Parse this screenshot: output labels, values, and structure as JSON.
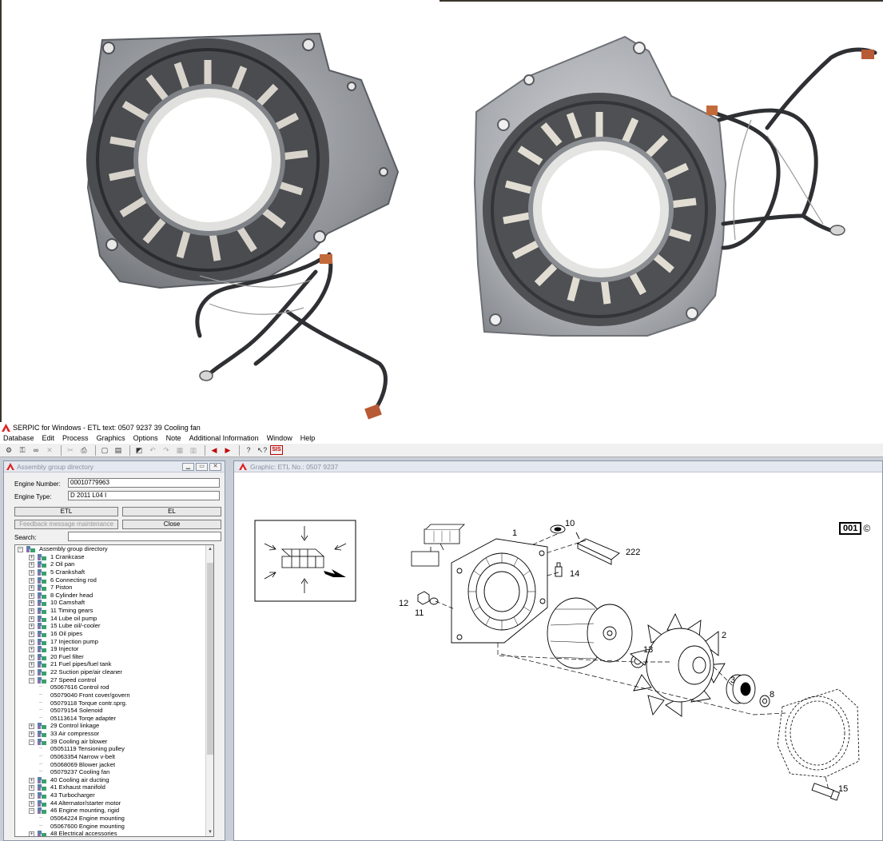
{
  "window": {
    "title": "SERPIC for Windows - ETL text: 0507 9237   39   Cooling fan"
  },
  "menu": [
    "Database",
    "Edit",
    "Process",
    "Graphics",
    "Options",
    "Note",
    "Additional Information",
    "Window",
    "Help"
  ],
  "toolbar": {
    "sis_label": "SIS"
  },
  "left_pane": {
    "title": "Assembly group directory",
    "engine_number_label": "Engine Number:",
    "engine_number_value": "00010779963",
    "engine_type_label": "Engine Type:",
    "engine_type_value": "D 2011 L04 I",
    "etl_button": "ETL",
    "el_button": "EL",
    "feedback_button": "Feedback message maintenance",
    "close_button": "Close",
    "search_label": "Search:",
    "search_value": "",
    "tree": [
      {
        "type": "root",
        "label": "Assembly group directory"
      },
      {
        "type": "group",
        "label": "1  Crankcase"
      },
      {
        "type": "group",
        "label": "2  Oil pan"
      },
      {
        "type": "group",
        "label": "5  Crankshaft"
      },
      {
        "type": "group",
        "label": "6  Connecting rod"
      },
      {
        "type": "group",
        "label": "7  Piston"
      },
      {
        "type": "group",
        "label": "8  Cylinder head"
      },
      {
        "type": "group",
        "label": "10  Camshaft"
      },
      {
        "type": "group",
        "label": "11  Timing gears"
      },
      {
        "type": "group",
        "label": "14  Lube oil pump"
      },
      {
        "type": "group",
        "label": "15  Lube oil/-cooler"
      },
      {
        "type": "group",
        "label": "16  Oil pipes"
      },
      {
        "type": "group",
        "label": "17  Injection pump"
      },
      {
        "type": "group",
        "label": "19  Injector"
      },
      {
        "type": "group",
        "label": "20  Fuel filter"
      },
      {
        "type": "group",
        "label": "21  Fuel pipes/fuel tank"
      },
      {
        "type": "group",
        "label": "22  Suction pipe/air cleaner"
      },
      {
        "type": "open",
        "label": "27  Speed control"
      },
      {
        "type": "leaf",
        "label": "05067616  Control rod"
      },
      {
        "type": "leaf",
        "label": "05079040  Front cover/govern"
      },
      {
        "type": "leaf",
        "label": "05079118  Torque contr.sprg."
      },
      {
        "type": "leaf",
        "label": "05079154  Solenoid"
      },
      {
        "type": "leaf",
        "label": "05113614  Torqe adapter"
      },
      {
        "type": "group",
        "label": "29  Control linkage"
      },
      {
        "type": "group",
        "label": "33  Air compressor"
      },
      {
        "type": "open",
        "label": "39  Cooling air blower"
      },
      {
        "type": "leaf",
        "label": "05051119  Tensioning pulley"
      },
      {
        "type": "leaf",
        "label": "05063354  Narrow v-belt"
      },
      {
        "type": "leaf",
        "label": "05068069  Blower jacket"
      },
      {
        "type": "leaf",
        "label": "05079237  Cooling fan"
      },
      {
        "type": "group",
        "label": "40  Cooling air ducting"
      },
      {
        "type": "group",
        "label": "41  Exhaust manifold"
      },
      {
        "type": "group",
        "label": "43  Turbocharger"
      },
      {
        "type": "group",
        "label": "44  Alternator/starter motor"
      },
      {
        "type": "open",
        "label": "46  Engine mounting, rigid"
      },
      {
        "type": "leaf",
        "label": "05064224  Engine mounting"
      },
      {
        "type": "leaf",
        "label": "05067600  Engine mounting"
      },
      {
        "type": "group",
        "label": "48  Electrical accessories"
      }
    ]
  },
  "right_pane": {
    "title": "Graphic: ETL No.: 0507 9237",
    "drawing_code": "001",
    "copyright": "©",
    "callouts": [
      "1",
      "10",
      "222",
      "14",
      "12",
      "11",
      "13",
      "2",
      "3",
      "8",
      "15"
    ]
  }
}
